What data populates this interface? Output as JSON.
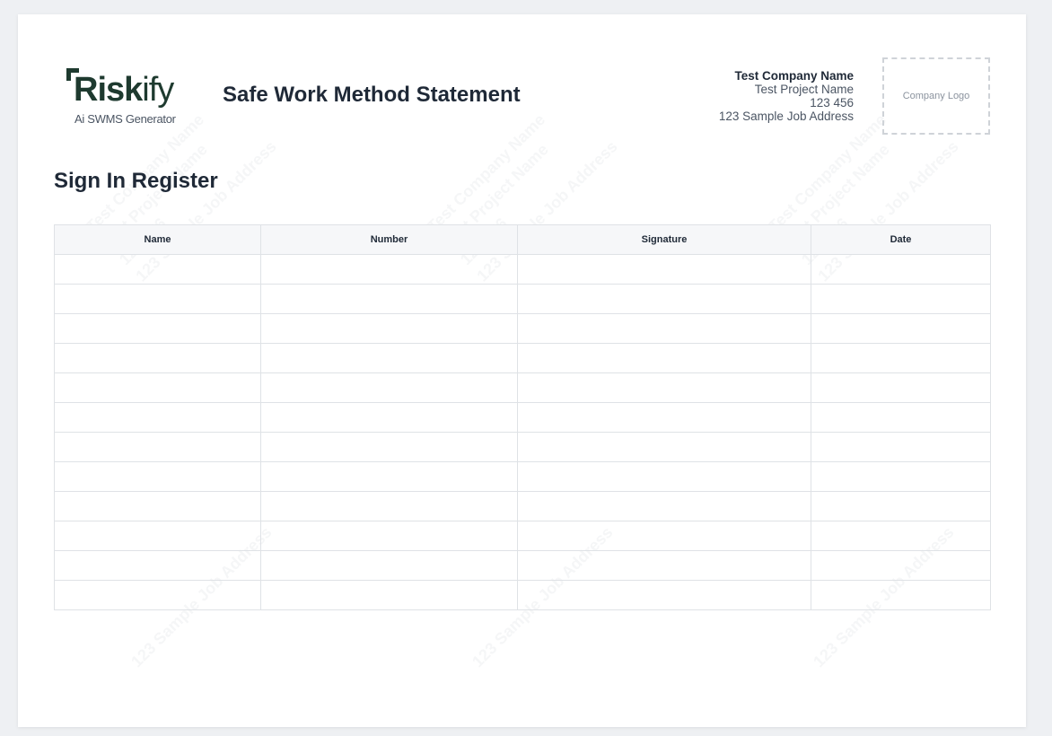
{
  "header": {
    "logo_word_bold": "Risk",
    "logo_word_light": "ify",
    "logo_tagline": "Ai SWMS Generator",
    "title": "Safe Work Method Statement"
  },
  "company": {
    "name": "Test Company Name",
    "project": "Test Project Name",
    "number": "123 456",
    "address": "123 Sample Job Address",
    "logo_placeholder": "Company Logo"
  },
  "watermark": {
    "lines": [
      "Test Company Name",
      "Test Project Name",
      "123 456",
      "123 Sample Job Address"
    ]
  },
  "register": {
    "title": "Sign In Register",
    "columns": [
      "Name",
      "Number",
      "Signature",
      "Date"
    ],
    "rows": [
      [
        "",
        "",
        "",
        ""
      ],
      [
        "",
        "",
        "",
        ""
      ],
      [
        "",
        "",
        "",
        ""
      ],
      [
        "",
        "",
        "",
        ""
      ],
      [
        "",
        "",
        "",
        ""
      ],
      [
        "",
        "",
        "",
        ""
      ],
      [
        "",
        "",
        "",
        ""
      ],
      [
        "",
        "",
        "",
        ""
      ],
      [
        "",
        "",
        "",
        ""
      ],
      [
        "",
        "",
        "",
        ""
      ],
      [
        "",
        "",
        "",
        ""
      ],
      [
        "",
        "",
        "",
        ""
      ]
    ]
  }
}
